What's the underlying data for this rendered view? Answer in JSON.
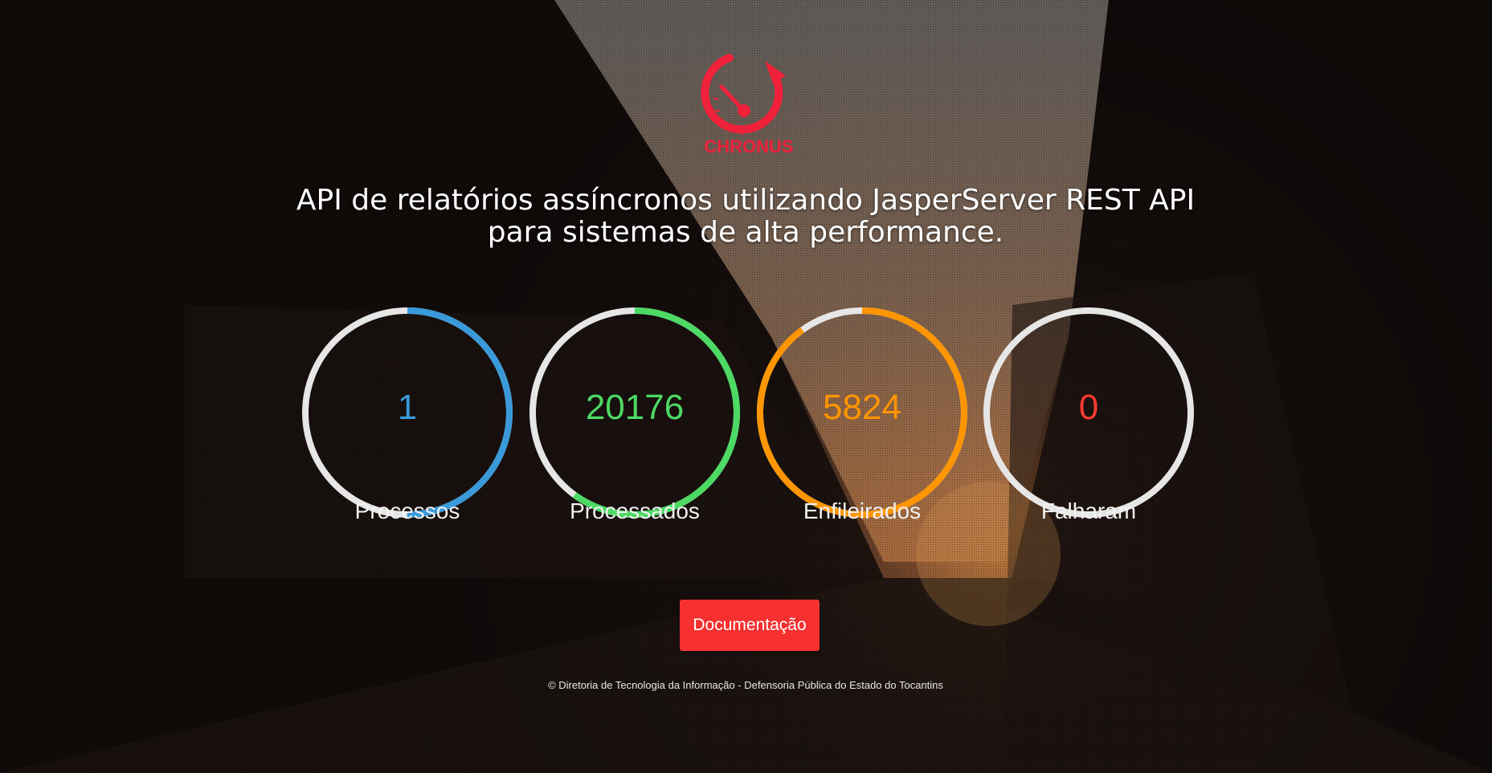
{
  "brand": {
    "name": "CHRONUS",
    "color": "#f0213a"
  },
  "headline": "API de relatórios assíncronos utilizando JasperServer REST API para sistemas de alta performance.",
  "stats": [
    {
      "label": "Processos",
      "value": "1",
      "color": "#3a9ad9",
      "fraction": 0.5
    },
    {
      "label": "Processados",
      "value": "20176",
      "color": "#4cd964",
      "fraction": 0.6
    },
    {
      "label": "Enfileirados",
      "value": "5824",
      "color": "#ff9500",
      "fraction": 0.9
    },
    {
      "label": "Falharam",
      "value": "0",
      "color": "#ff3b30",
      "fraction": 0.0
    }
  ],
  "ring_track_color": "#e6e6e6",
  "cta": {
    "label": "Documentação",
    "color": "#f5302f"
  },
  "footer": "© Diretoria de Tecnologia da Informação - Defensoria Pública do Estado do Tocantins"
}
